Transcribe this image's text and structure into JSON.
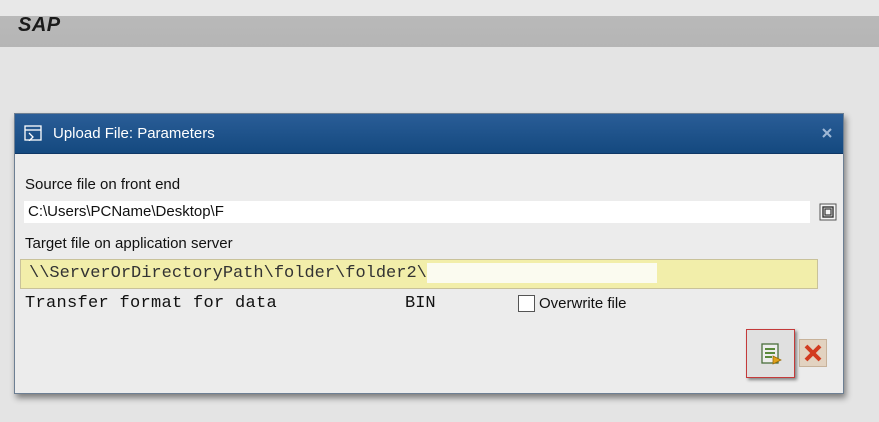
{
  "app": {
    "logo": "SAP"
  },
  "dialog": {
    "title": "Upload File: Parameters",
    "source_label": "Source file on front end",
    "source_value": "C:\\Users\\PCName\\Desktop\\F",
    "target_label": "Target file on application server",
    "target_value": "\\\\ServerOrDirectoryPath\\folder\\folder2\\",
    "format_label": "Transfer format for data",
    "format_value": "BIN",
    "overwrite_label": "Overwrite file",
    "overwrite_checked": false
  },
  "icons": {
    "title": "upload-dialog-icon",
    "browse": "browse-file-icon",
    "ok": "continue-icon",
    "cancel": "cancel-icon",
    "close": "close-icon"
  },
  "colors": {
    "titlebar": "#1c5089",
    "target_field": "#f2eeaa",
    "ok_border": "#c43a3a"
  }
}
